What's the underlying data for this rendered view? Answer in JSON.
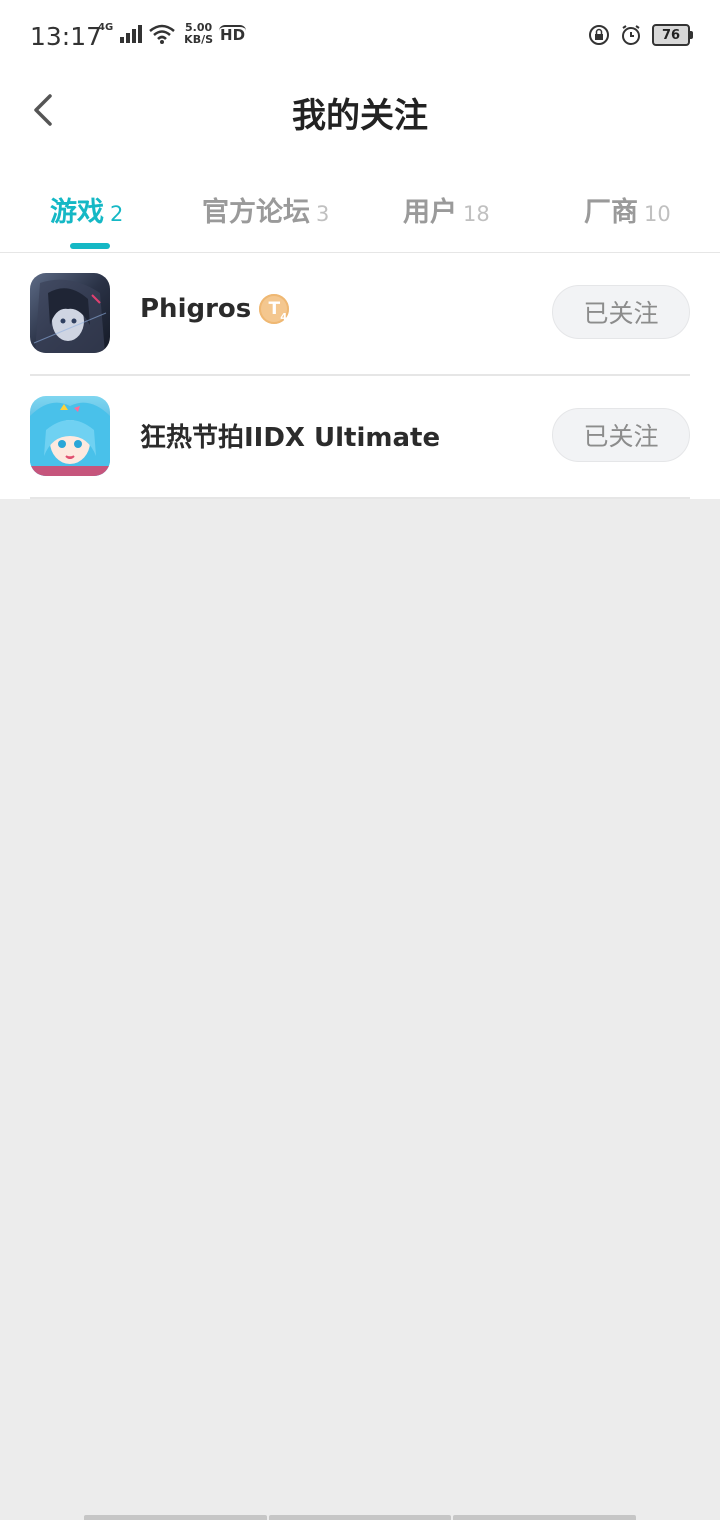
{
  "status_bar": {
    "time": "13:17",
    "network": "4G",
    "speed_value": "5.00",
    "speed_unit": "KB/S",
    "hd": "HD",
    "battery": "76"
  },
  "header": {
    "title": "我的关注"
  },
  "tabs": [
    {
      "label": "游戏",
      "count": "2",
      "active": true
    },
    {
      "label": "官方论坛",
      "count": "3",
      "active": false
    },
    {
      "label": "用户",
      "count": "18",
      "active": false
    },
    {
      "label": "厂商",
      "count": "10",
      "active": false
    }
  ],
  "games": [
    {
      "name": "Phigros",
      "badge": "T",
      "badge_sub": "4",
      "button": "已关注"
    },
    {
      "name": "狂热节拍IIDX Ultimate",
      "button": "已关注"
    }
  ],
  "colors": {
    "accent": "#15b8c5",
    "background": "#ececec"
  }
}
